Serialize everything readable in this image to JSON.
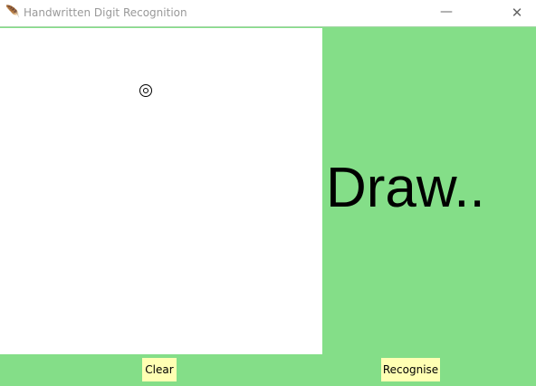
{
  "window": {
    "title": "Handwritten Digit Recognition",
    "minimize": "—",
    "close": "✕"
  },
  "main": {
    "result_label": "Draw..",
    "clear_label": "Clear",
    "recognise_label": "Recognise"
  },
  "colors": {
    "background": "#84de88",
    "button": "#ffffb3",
    "canvas": "#ffffff"
  }
}
